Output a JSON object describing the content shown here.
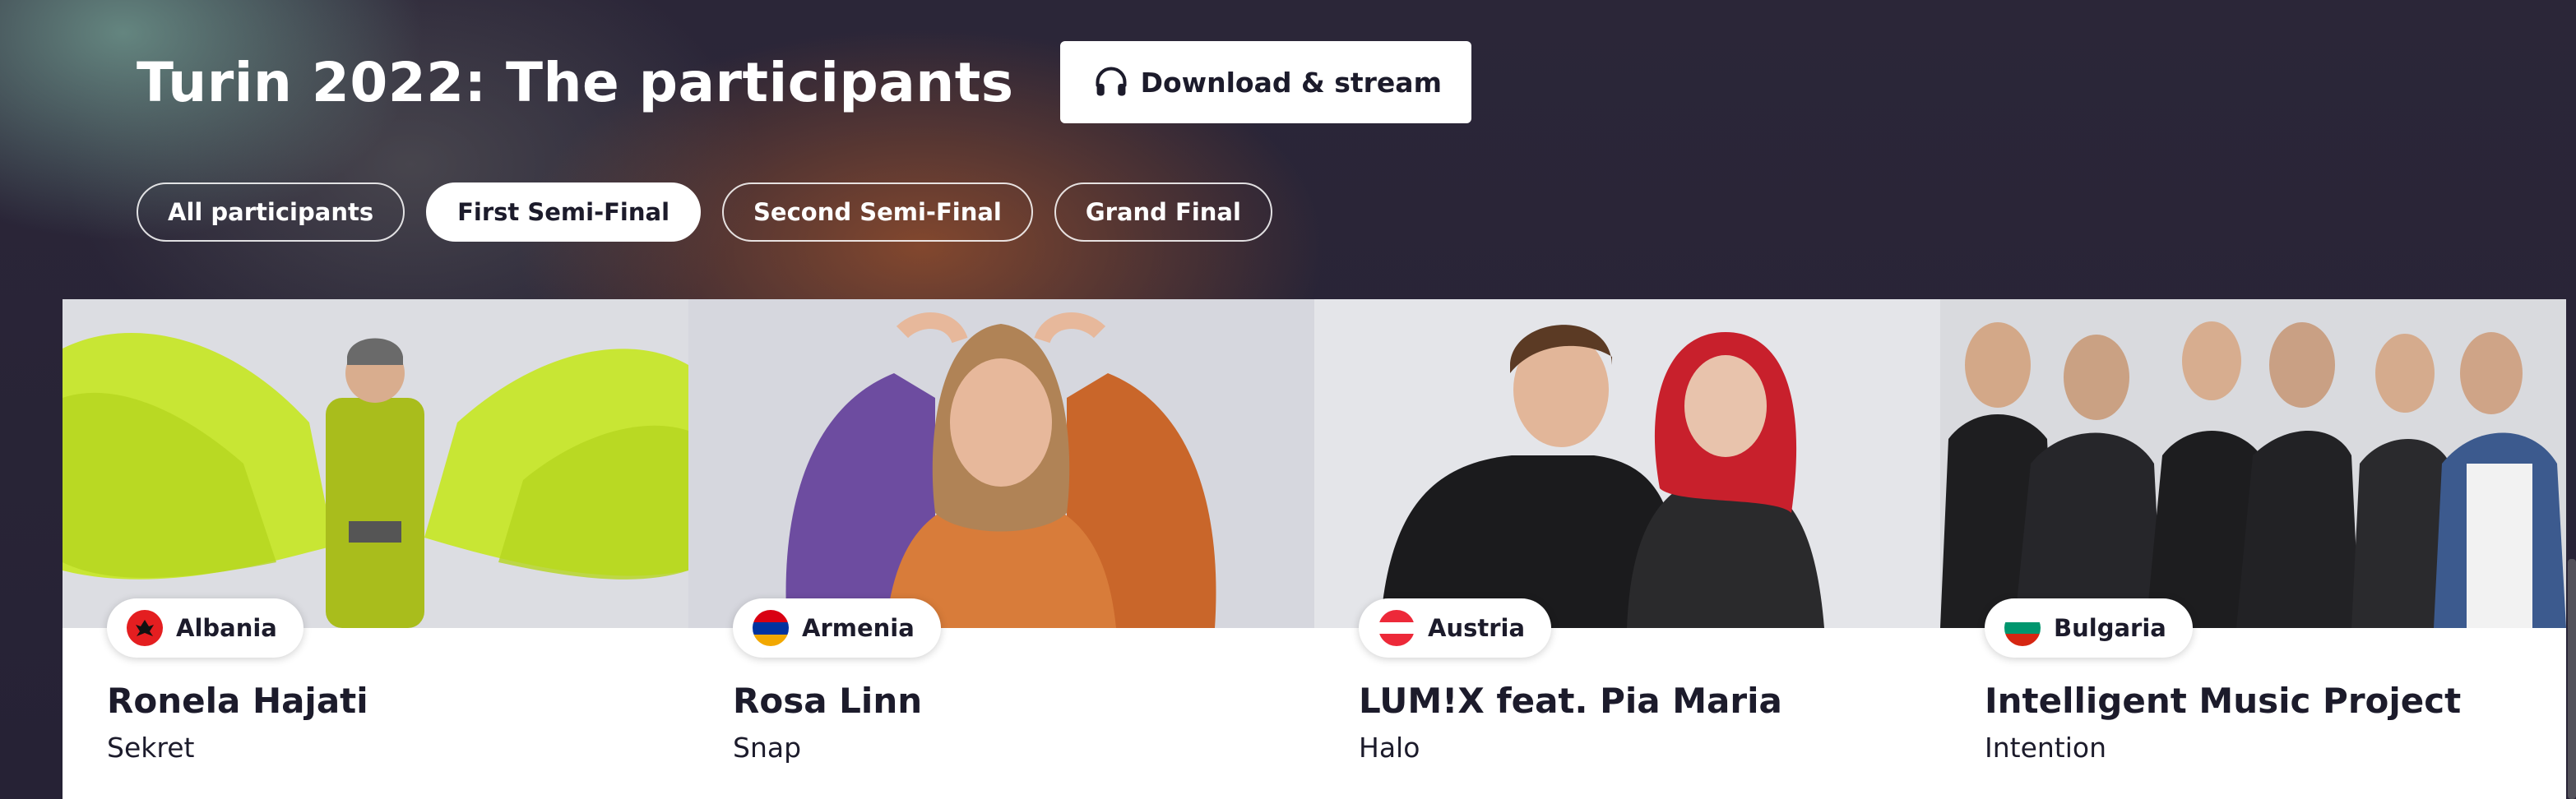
{
  "page": {
    "title": "Turin 2022: The participants",
    "download_label": "Download & stream"
  },
  "filters": [
    {
      "label": "All participants",
      "active": false
    },
    {
      "label": "First Semi-Final",
      "active": true
    },
    {
      "label": "Second Semi-Final",
      "active": false
    },
    {
      "label": "Grand Final",
      "active": false
    }
  ],
  "participants": [
    {
      "country": "Albania",
      "artist": "Ronela Hajati",
      "song": "Sekret",
      "flag_icon": "albania-flag-icon"
    },
    {
      "country": "Armenia",
      "artist": "Rosa Linn",
      "song": "Snap",
      "flag_icon": "armenia-flag-icon"
    },
    {
      "country": "Austria",
      "artist": "LUM!X feat. Pia Maria",
      "song": "Halo",
      "flag_icon": "austria-flag-icon"
    },
    {
      "country": "Bulgaria",
      "artist": "Intelligent Music Project",
      "song": "Intention",
      "flag_icon": "bulgaria-flag-icon"
    }
  ],
  "colors": {
    "text_dark": "#1c1b2b",
    "bg_dark": "#262235",
    "accent_green": "#c8e634"
  }
}
